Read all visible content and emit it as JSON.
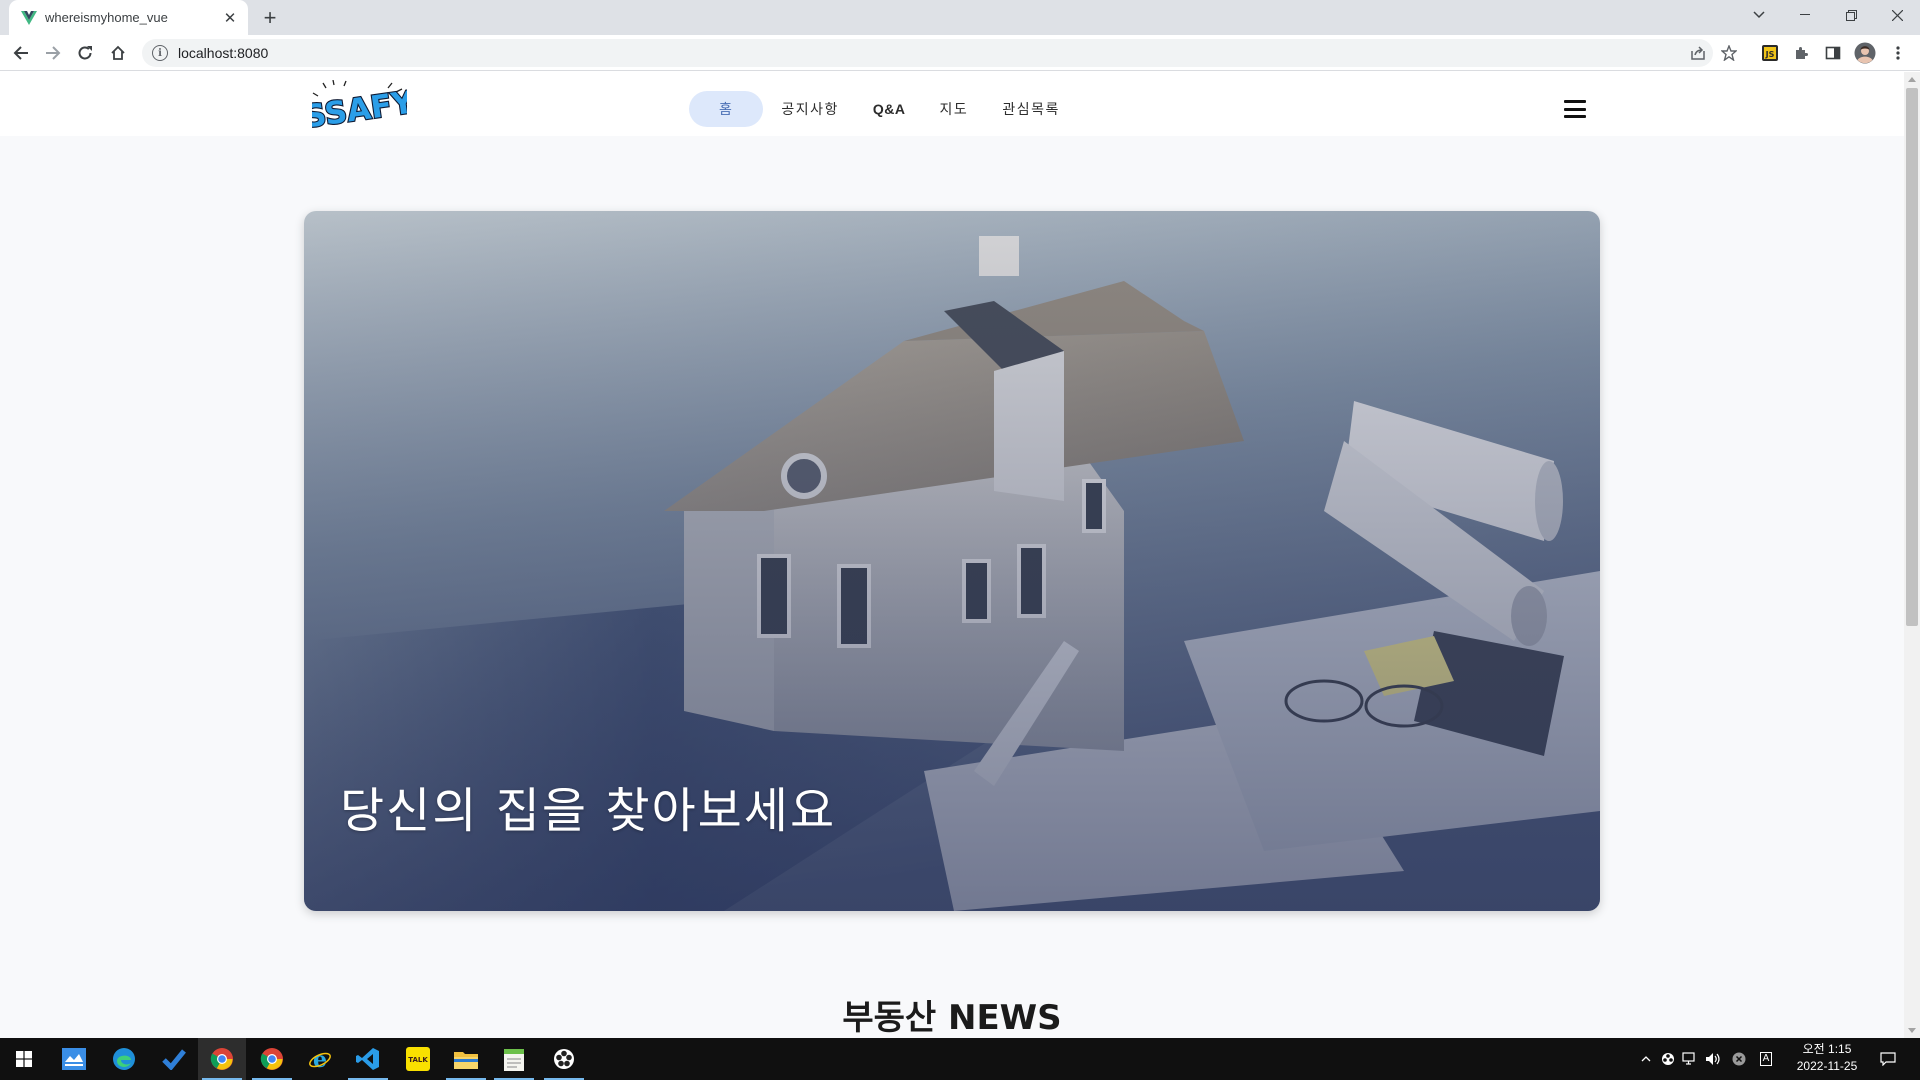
{
  "browser": {
    "tab_title": "whereismyhome_vue",
    "tab_close": "✕",
    "new_tab": "+",
    "url": "localhost:8080"
  },
  "site": {
    "logo_text": "SSAFY",
    "nav": [
      {
        "label": "홈",
        "active": true
      },
      {
        "label": "공지사항"
      },
      {
        "label": "Q&A"
      },
      {
        "label": "지도"
      },
      {
        "label": "관심목록"
      }
    ],
    "hero_caption": "당신의 집을 찾아보세요",
    "section_title": "부동산 NEWS"
  },
  "taskbar": {
    "apps": [
      "windows-start",
      "outlook",
      "edge",
      "todo",
      "chrome",
      "chrome",
      "internet-explorer",
      "vscode",
      "kakaotalk",
      "file-explorer",
      "notepad",
      "media"
    ],
    "kakao_label": "TALK",
    "ime": "A",
    "clock_time": "오전 1:15",
    "clock_date": "2022-11-25"
  }
}
